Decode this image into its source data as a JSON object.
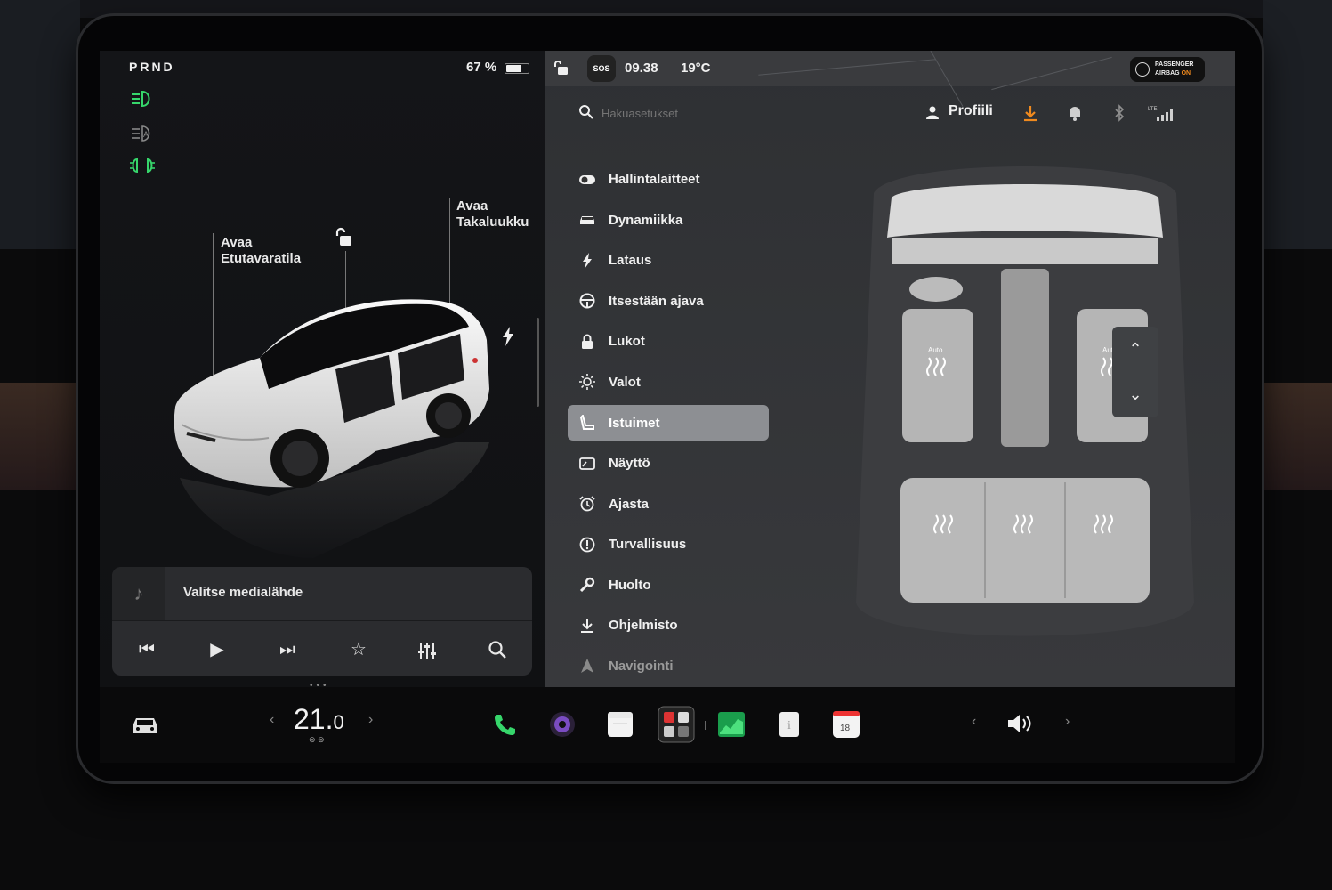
{
  "drive": {
    "gear": "PRND",
    "battery": "67 %",
    "battery_level": 0.67
  },
  "car_labels": {
    "frunk_line1": "Avaa",
    "frunk_line2": "Etutavaratila",
    "trunk_line1": "Avaa",
    "trunk_line2": "Takaluukku"
  },
  "media": {
    "title": "Valitse medialähde"
  },
  "status": {
    "time": "09.38",
    "temperature": "19°C",
    "sos": "SOS",
    "airbag_line1": "PASSENGER",
    "airbag_line2_a": "AIRBAG ",
    "airbag_line2_b": "ON"
  },
  "search": {
    "placeholder": "Hakuasetukset"
  },
  "profile": {
    "label": "Profiili"
  },
  "menu": {
    "items": [
      {
        "label": "Hallintalaitteet",
        "icon": "toggle-icon"
      },
      {
        "label": "Dynamiikka",
        "icon": "car-icon"
      },
      {
        "label": "Lataus",
        "icon": "bolt-icon"
      },
      {
        "label": "Itsestään ajava",
        "icon": "steering-wheel-icon"
      },
      {
        "label": "Lukot",
        "icon": "lock-icon"
      },
      {
        "label": "Valot",
        "icon": "sun-icon"
      },
      {
        "label": "Istuimet",
        "icon": "seat-icon",
        "active": true
      },
      {
        "label": "Näyttö",
        "icon": "display-icon"
      },
      {
        "label": "Ajasta",
        "icon": "alarm-icon"
      },
      {
        "label": "Turvallisuus",
        "icon": "info-icon"
      },
      {
        "label": "Huolto",
        "icon": "wrench-icon"
      },
      {
        "label": "Ohjelmisto",
        "icon": "download-icon"
      },
      {
        "label": "Navigointi",
        "icon": "navigation-icon"
      }
    ]
  },
  "seats": {
    "front_left": "Auto",
    "front_right": "Auto"
  },
  "climate": {
    "temp_whole": "21.",
    "temp_decimal": "0"
  },
  "dock": {
    "calendar_day": "18"
  },
  "colors": {
    "accent_green": "#36d66b",
    "download_orange": "#f08a1e",
    "active_menu": "#8d8f93"
  }
}
